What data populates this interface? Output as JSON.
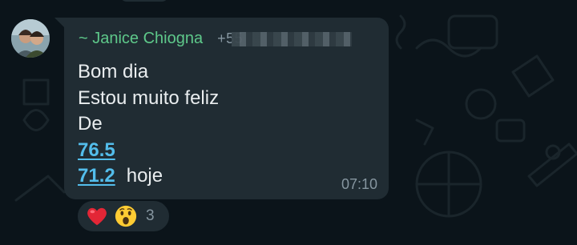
{
  "message": {
    "sender_name": "~ Janice Chiogna",
    "sender_phone": "+55",
    "lines": [
      "Bom dia",
      "Estou muito feliz",
      "De"
    ],
    "readings": [
      {
        "value": "76.5",
        "suffix": ""
      },
      {
        "value": "71.2",
        "suffix": "hoje"
      }
    ],
    "time": "07:10"
  },
  "reactions": {
    "emojis": [
      "heart",
      "surprised-face"
    ],
    "count": "3"
  },
  "colors": {
    "background": "#0b141a",
    "bubble": "#202c33",
    "sender": "#5ec88a",
    "link": "#53bdeb",
    "text": "#e9edef",
    "meta": "#8696a0"
  }
}
